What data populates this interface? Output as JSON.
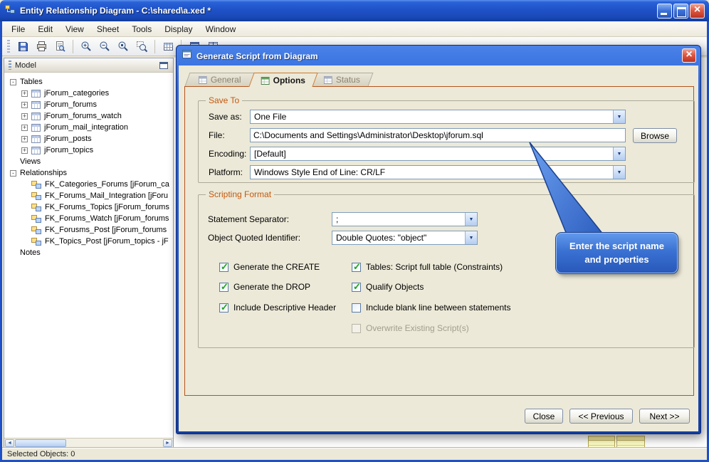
{
  "window": {
    "title": "Entity Relationship Diagram - C:\\shared\\a.xed *",
    "menu": [
      "File",
      "Edit",
      "View",
      "Sheet",
      "Tools",
      "Display",
      "Window"
    ],
    "toolbar": [
      "save",
      "print",
      "print-preview",
      "zoom-in",
      "zoom-out",
      "zoom-actual-size",
      "zoom-selection",
      "table-grid",
      "new-window",
      "split-view"
    ],
    "status": "Selected Objects: 0"
  },
  "model_panel": {
    "title": "Model",
    "tree": [
      {
        "label": "Tables",
        "expander": "-",
        "icon": "none"
      },
      {
        "label": "jForum_categories",
        "expander": "+",
        "icon": "table"
      },
      {
        "label": "jForum_forums",
        "expander": "+",
        "icon": "table"
      },
      {
        "label": "jForum_forums_watch",
        "expander": "+",
        "icon": "table"
      },
      {
        "label": "jForum_mail_integration",
        "expander": "+",
        "icon": "table"
      },
      {
        "label": "jForum_posts",
        "expander": "+",
        "icon": "table"
      },
      {
        "label": "jForum_topics",
        "expander": "+",
        "icon": "table"
      },
      {
        "label": "Views",
        "expander": "",
        "icon": "none"
      },
      {
        "label": "Relationships",
        "expander": "-",
        "icon": "none"
      },
      {
        "label": "FK_Categories_Forums [jForum_ca",
        "expander": "",
        "icon": "fk"
      },
      {
        "label": "FK_Forums_Mail_Integration [jForu",
        "expander": "",
        "icon": "fk"
      },
      {
        "label": "FK_Forums_Topics [jForum_forums",
        "expander": "",
        "icon": "fk"
      },
      {
        "label": "FK_Forums_Watch [jForum_forums",
        "expander": "",
        "icon": "fk"
      },
      {
        "label": "FK_Forusms_Post [jForum_forums",
        "expander": "",
        "icon": "fk"
      },
      {
        "label": "FK_Topics_Post [jForum_topics - jF",
        "expander": "",
        "icon": "fk"
      },
      {
        "label": "Notes",
        "expander": "",
        "icon": "none"
      }
    ]
  },
  "dialog": {
    "title": "Generate Script from Diagram",
    "tabs": [
      {
        "label": "General",
        "active": false
      },
      {
        "label": "Options",
        "active": true
      },
      {
        "label": "Status",
        "active": false
      }
    ],
    "save_to": {
      "legend": "Save To",
      "save_as_label": "Save as:",
      "save_as_value": "One File",
      "file_label": "File:",
      "file_value": "C:\\Documents and Settings\\Administrator\\Desktop\\jforum.sql",
      "browse_label": "Browse",
      "encoding_label": "Encoding:",
      "encoding_value": "[Default]",
      "platform_label": "Platform:",
      "platform_value": "Windows Style End of Line: CR/LF"
    },
    "scripting_format": {
      "legend": "Scripting Format",
      "statement_separator_label": "Statement Separator:",
      "statement_separator_value": ";",
      "object_quoted_label": "Object Quoted Identifier:",
      "object_quoted_value": "Double Quotes: \"object\"",
      "checkboxes_left": [
        {
          "label": "Generate the CREATE",
          "checked": true
        },
        {
          "label": "Generate the DROP",
          "checked": true
        },
        {
          "label": "Include Descriptive Header",
          "checked": true
        }
      ],
      "checkboxes_right": [
        {
          "label": "Tables: Script full table (Constraints)",
          "checked": true
        },
        {
          "label": "Qualify Objects",
          "checked": true
        },
        {
          "label": "Include blank line between statements",
          "checked": false
        },
        {
          "label": "Overwrite Existing Script(s)",
          "checked": false,
          "disabled": true
        }
      ]
    },
    "buttons": {
      "close": "Close",
      "previous": "<< Previous",
      "next": "Next >>"
    },
    "callout": {
      "text": "Enter the script name and properties"
    }
  },
  "colors": {
    "titlebar": "#1e50c8",
    "callout_blue": "#3a71d2",
    "group_legend": "#c3590e",
    "tab_frame_border": "#b5541c",
    "check_green": "#1ea11e",
    "close_red": "#bd3220"
  }
}
